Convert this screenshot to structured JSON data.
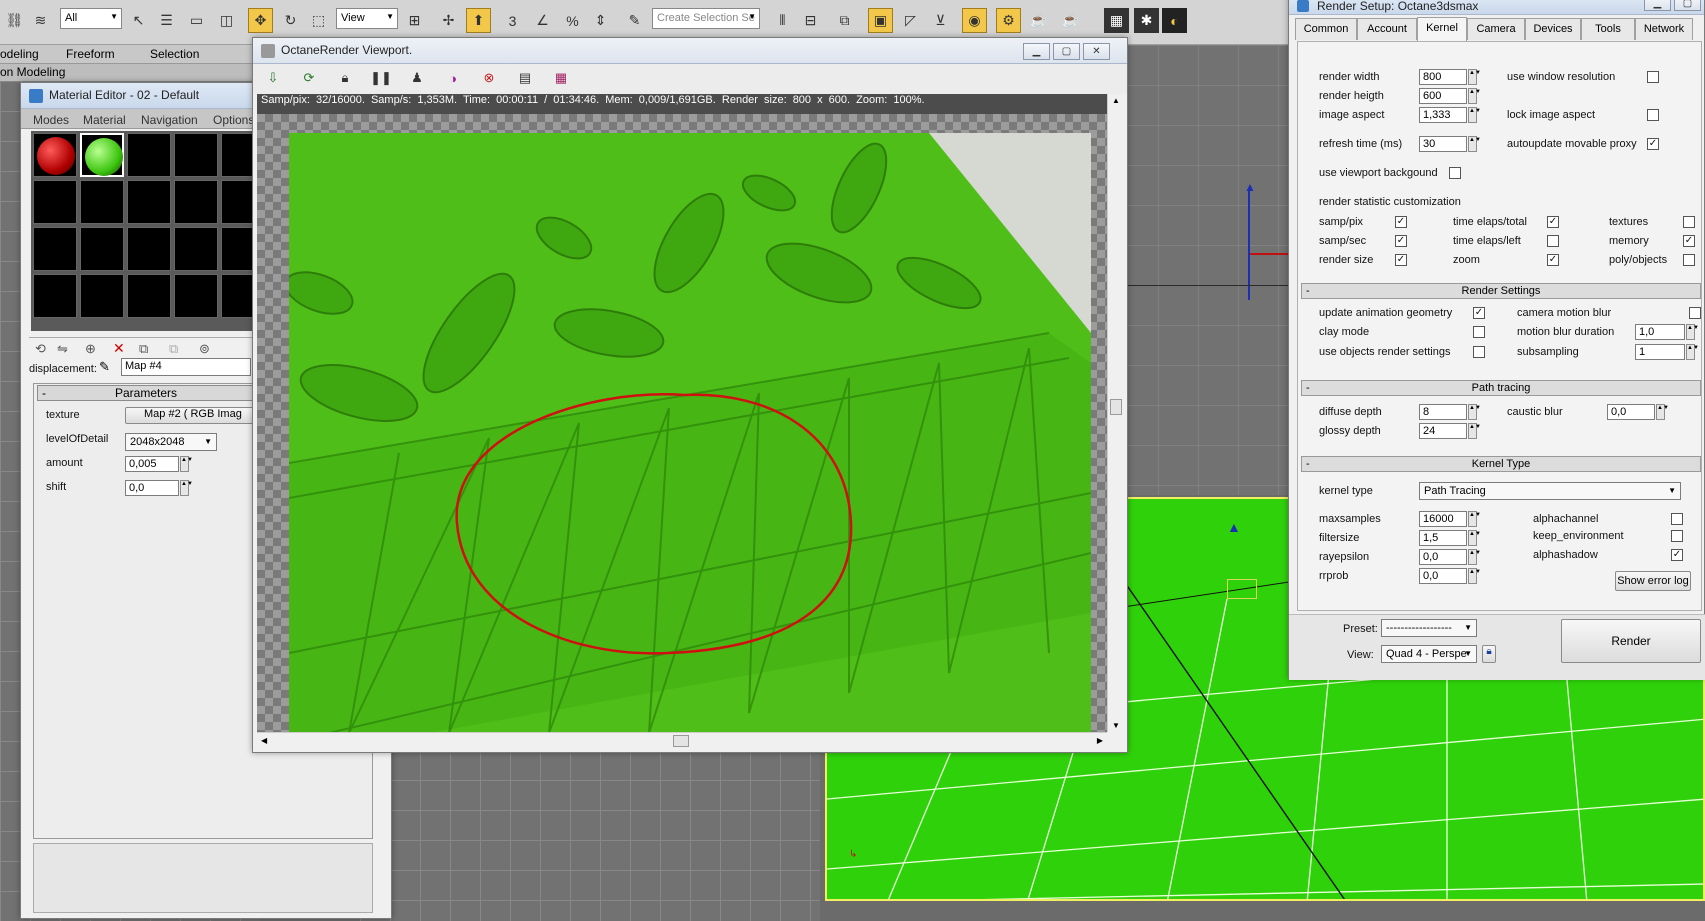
{
  "toolbar": {
    "selection_filter": "All",
    "ref_coord": "View",
    "selection_set_placeholder": "Create Selection Se",
    "snap_number": "3",
    "percent_snap": "%"
  },
  "ribbon": {
    "tabs": [
      "odeling",
      "Freeform",
      "Selection"
    ],
    "subtab": "on Modeling"
  },
  "material_editor": {
    "title": "Material Editor - 02 - Default",
    "menu": [
      "Modes",
      "Material",
      "Navigation",
      "Options"
    ],
    "displacement_label": "displacement:",
    "displacement_value": "Map #4",
    "params_header": "Parameters",
    "texture_label": "texture",
    "texture_value": "Map #2  ( RGB Imag",
    "lod_label": "levelOfDetail",
    "lod_value": "2048x2048",
    "amount_label": "amount",
    "amount_value": "0,005",
    "shift_label": "shift",
    "shift_value": "0,0"
  },
  "octane": {
    "title": "OctaneRender Viewport.",
    "status": "Samp/pix: 32/16000.   Samp/s: 1,353M.   Time: 00:00:11 / 01:34:46.   Mem: 0,009/1,691GB.   Render size: 800 x 600.   Zoom: 100%."
  },
  "render_setup": {
    "title": "Render Setup: Octane3dsmax",
    "tabs": [
      "Common",
      "Account",
      "Kernel",
      "Camera",
      "Devices",
      "Tools",
      "Network"
    ],
    "active_tab": "Kernel",
    "render_width_label": "render width",
    "render_width": "800",
    "render_height_label": "render heigth",
    "render_height": "600",
    "image_aspect_label": "image aspect",
    "image_aspect": "1,333",
    "refresh_label": "refresh time (ms)",
    "refresh": "30",
    "use_window_res": "use window resolution",
    "lock_aspect": "lock image aspect",
    "autoupdate_proxy": "autoupdate movable proxy",
    "use_vp_bg": "use viewport backgound",
    "stat_custom": "render statistic customization",
    "stat": {
      "samp_pix": "samp/pix",
      "samp_sec": "samp/sec",
      "render_size": "render size",
      "time_total": "time elaps/total",
      "time_left": "time elaps/left",
      "zoom": "zoom",
      "textures": "textures",
      "memory": "memory",
      "poly": "poly/objects"
    },
    "render_settings_header": "Render Settings",
    "update_anim": "update animation geometry",
    "clay_mode": "clay mode",
    "use_obj_settings": "use objects render settings",
    "cam_motion_blur": "camera motion blur",
    "mb_duration_label": "motion blur duration",
    "mb_duration": "1,0",
    "subsampling_label": "subsampling",
    "subsampling": "1",
    "path_tracing_header": "Path tracing",
    "diffuse_label": "diffuse depth",
    "diffuse": "8",
    "glossy_label": "glossy depth",
    "glossy": "24",
    "caustic_label": "caustic blur",
    "caustic": "0,0",
    "kernel_type_header": "Kernel Type",
    "kernel_type_label": "kernel type",
    "kernel_type": "Path Tracing",
    "maxsamples_label": "maxsamples",
    "maxsamples": "16000",
    "filtersize_label": "filtersize",
    "filtersize": "1,5",
    "rayepsilon_label": "rayepsilon",
    "rayepsilon": "0,0",
    "rrprob_label": "rrprob",
    "rrprob": "0,0",
    "alphachannel": "alphachannel",
    "keep_env": "keep_environment",
    "alphashadow": "alphashadow",
    "show_error_log": "Show error log",
    "preset_label": "Preset:",
    "preset_value": "------------------",
    "view_label": "View:",
    "view_value": "Quad 4 - Perspe",
    "render_button": "Render"
  },
  "colors": {
    "render_green": "#4fc21a",
    "viewport_green": "#2fd10a",
    "annotation_red": "#d01010",
    "toolbar_active": "#f3c84a"
  }
}
